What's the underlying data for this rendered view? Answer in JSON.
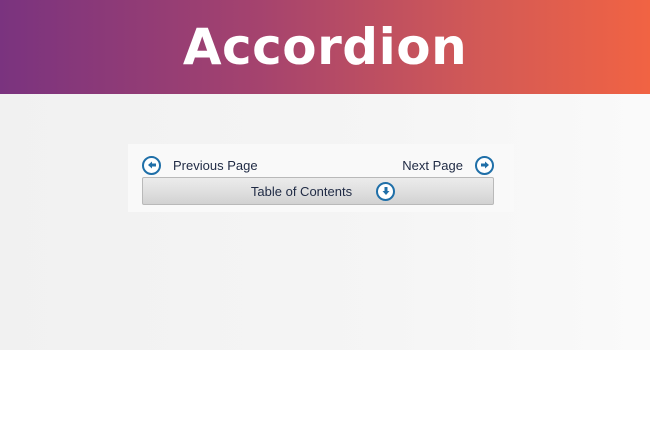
{
  "banner": {
    "title": "Accordion"
  },
  "nav": {
    "previous_label": "Previous Page",
    "next_label": "Next Page",
    "previous_icon": "arrow-left-circle-icon",
    "next_icon": "arrow-right-circle-icon"
  },
  "toc": {
    "label": "Table of Contents",
    "icon": "arrow-down-circle-icon"
  },
  "colors": {
    "banner_gradient_start": "#7a337f",
    "banner_gradient_end": "#f16343",
    "icon_blue": "#1f6fa8",
    "text": "#1f2a44"
  }
}
